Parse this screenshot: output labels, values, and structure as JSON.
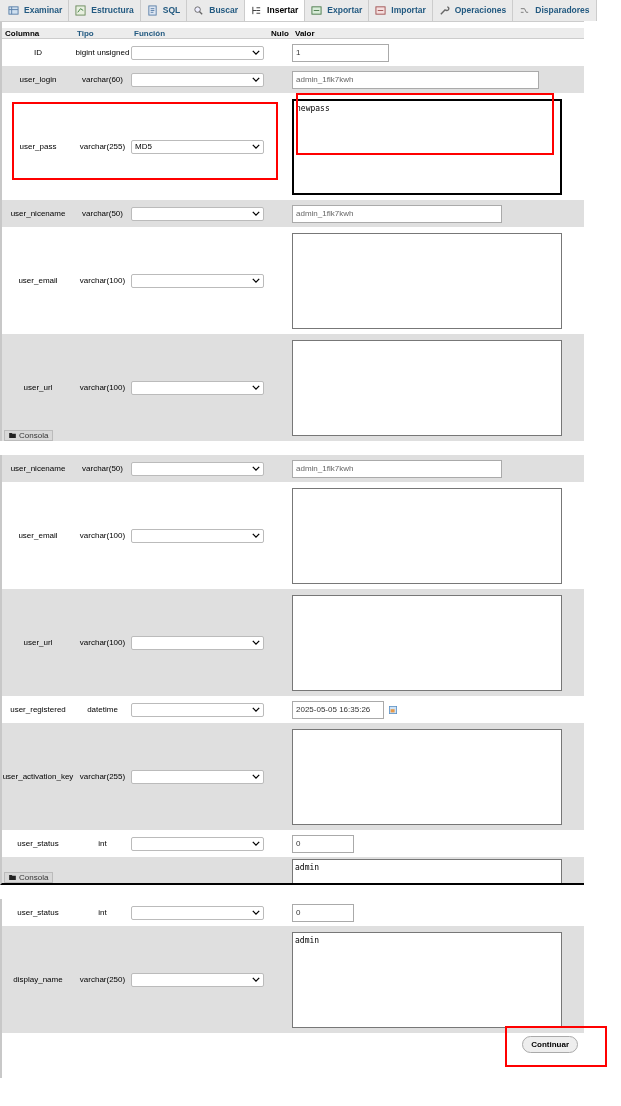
{
  "panels": [
    {
      "tabs": [
        {
          "label": "Examinar",
          "selected": false
        },
        {
          "label": "Estructura",
          "selected": false
        },
        {
          "label": "SQL",
          "selected": false
        },
        {
          "label": "Buscar",
          "selected": false
        },
        {
          "label": "Insertar",
          "selected": true
        },
        {
          "label": "Exportar",
          "selected": false
        },
        {
          "label": "Importar",
          "selected": false
        },
        {
          "label": "Operaciones",
          "selected": false
        },
        {
          "label": "Disparadores",
          "selected": false
        }
      ],
      "header": [
        {
          "label": "Columna",
          "sortable": false
        },
        {
          "label": "Tipo",
          "sortable": true
        },
        {
          "label": "Función",
          "sortable": true
        },
        {
          "label": "Nulo",
          "sortable": false
        },
        {
          "label": "Valor",
          "sortable": false
        }
      ],
      "rows": [
        {
          "column": "ID",
          "type": "bigint unsigned",
          "function": "",
          "kind": "short",
          "value": "1",
          "shaded": false
        },
        {
          "column": "user_login",
          "type": "varchar(60)",
          "function": "",
          "kind": "text",
          "value": "admin_1flk7kwh",
          "shaded": true
        },
        {
          "column": "user_pass",
          "type": "varchar(255)",
          "function": "MD5",
          "kind": "textarea",
          "value": "newpass",
          "shaded": false,
          "focused": true,
          "marked": true,
          "value_marked": true
        },
        {
          "column": "user_nicename",
          "type": "varchar(50)",
          "function": "",
          "kind": "text",
          "value": "admin_1flk7kwh",
          "shaded": true
        },
        {
          "column": "user_email",
          "type": "varchar(100)",
          "function": "",
          "kind": "textarea",
          "shaded": false
        },
        {
          "column": "user_url",
          "type": "varchar(100)",
          "function": "",
          "kind": "textarea",
          "shaded": true
        }
      ],
      "console": "Consola"
    },
    {
      "rows": [
        {
          "column": "user_nicename",
          "type": "varchar(50)",
          "function": "",
          "kind": "text",
          "value": "admin_1flk7kwh",
          "shaded": true
        },
        {
          "column": "user_email",
          "type": "varchar(100)",
          "function": "",
          "kind": "textarea",
          "shaded": false
        },
        {
          "column": "user_url",
          "type": "varchar(100)",
          "function": "",
          "kind": "textarea",
          "shaded": true
        },
        {
          "column": "user_registered",
          "type": "datetime",
          "function": "",
          "kind": "date",
          "value": "2025-05-05 16:35:26",
          "shaded": false
        },
        {
          "column": "user_activation_key",
          "type": "varchar(255)",
          "function": "",
          "kind": "textarea",
          "shaded": true
        },
        {
          "column": "user_status",
          "type": "int",
          "function": "",
          "kind": "short",
          "value": "0",
          "shaded": false
        },
        {
          "kind": "cut_textarea",
          "value": "admin",
          "shaded": true
        }
      ],
      "console": "Consola"
    },
    {
      "rows": [
        {
          "column": "user_status",
          "type": "int",
          "function": "",
          "kind": "short",
          "value": "0",
          "shaded": false
        },
        {
          "column": "display_name",
          "type": "varchar(250)",
          "function": "",
          "kind": "textarea",
          "value": "admin",
          "shaded": true
        }
      ],
      "button": {
        "label": "Continuar",
        "marked": true
      }
    }
  ]
}
